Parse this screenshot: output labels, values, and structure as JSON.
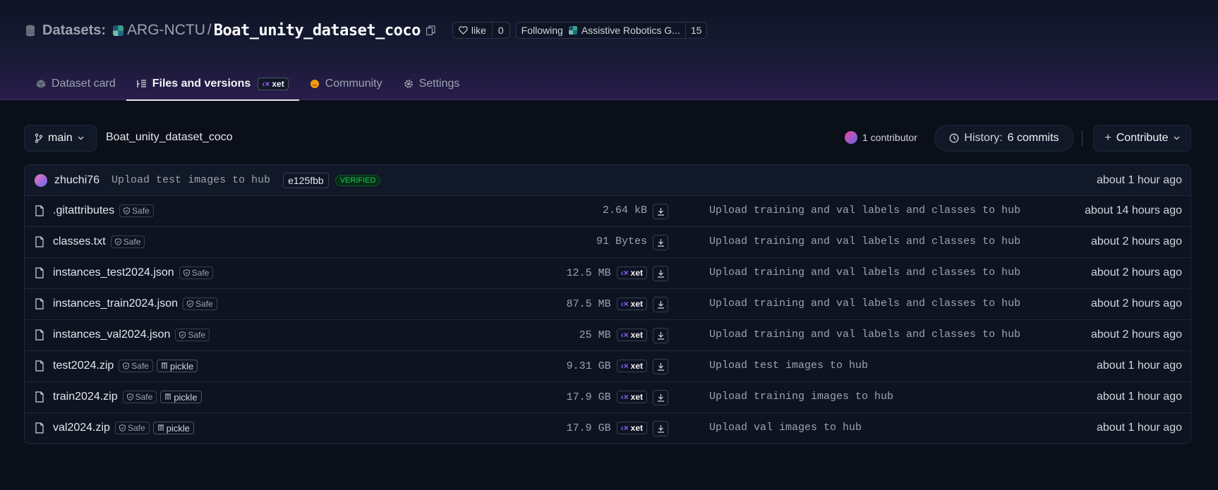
{
  "header": {
    "datasets_label": "Datasets:",
    "org": "ARG-NCTU",
    "slash": "/",
    "repo": "Boat_unity_dataset_coco",
    "like_label": "like",
    "like_count": "0",
    "following_label": "Following",
    "following_org": "Assistive Robotics G...",
    "following_count": "15"
  },
  "tabs": [
    {
      "label": "Dataset card"
    },
    {
      "label": "Files and versions",
      "badge": "xet"
    },
    {
      "label": "Community"
    },
    {
      "label": "Settings"
    }
  ],
  "toolbar": {
    "branch": "main",
    "path": "Boat_unity_dataset_coco",
    "contributors": "1 contributor",
    "history_label": "History:",
    "history_count": "6 commits",
    "contribute_label": "Contribute"
  },
  "last_commit": {
    "user": "zhuchi76",
    "message": "Upload test images to hub",
    "hash": "e125fbb",
    "verified": "VERIFIED",
    "time": "about 1 hour ago"
  },
  "files": [
    {
      "name": ".gitattributes",
      "safe": "Safe",
      "pickle": "",
      "size": "2.64 kB",
      "xet": "",
      "message": "Upload training and val labels and classes to hub",
      "time": "about 14 hours ago"
    },
    {
      "name": "classes.txt",
      "safe": "Safe",
      "pickle": "",
      "size": "91 Bytes",
      "xet": "",
      "message": "Upload training and val labels and classes to hub",
      "time": "about 2 hours ago"
    },
    {
      "name": "instances_test2024.json",
      "safe": "Safe",
      "pickle": "",
      "size": "12.5 MB",
      "xet": "xet",
      "message": "Upload training and val labels and classes to hub",
      "time": "about 2 hours ago"
    },
    {
      "name": "instances_train2024.json",
      "safe": "Safe",
      "pickle": "",
      "size": "87.5 MB",
      "xet": "xet",
      "message": "Upload training and val labels and classes to hub",
      "time": "about 2 hours ago"
    },
    {
      "name": "instances_val2024.json",
      "safe": "Safe",
      "pickle": "",
      "size": "25 MB",
      "xet": "xet",
      "message": "Upload training and val labels and classes to hub",
      "time": "about 2 hours ago"
    },
    {
      "name": "test2024.zip",
      "safe": "Safe",
      "pickle": "pickle",
      "size": "9.31 GB",
      "xet": "xet",
      "message": "Upload test images to hub",
      "time": "about 1 hour ago"
    },
    {
      "name": "train2024.zip",
      "safe": "Safe",
      "pickle": "pickle",
      "size": "17.9 GB",
      "xet": "xet",
      "message": "Upload training images to hub",
      "time": "about 1 hour ago"
    },
    {
      "name": "val2024.zip",
      "safe": "Safe",
      "pickle": "pickle",
      "size": "17.9 GB",
      "xet": "xet",
      "message": "Upload val images to hub",
      "time": "about 1 hour ago"
    }
  ],
  "icons": {
    "database": "database-icon",
    "copy": "copy-icon",
    "heart": "heart-icon",
    "branch": "git-branch-icon",
    "history": "clock-icon",
    "file": "file-icon",
    "download": "download-icon",
    "shield": "shield-icon"
  },
  "colors": {
    "background": "#0b0f19",
    "accent_xet": "#8b5cf6",
    "verified": "#22c55e"
  }
}
